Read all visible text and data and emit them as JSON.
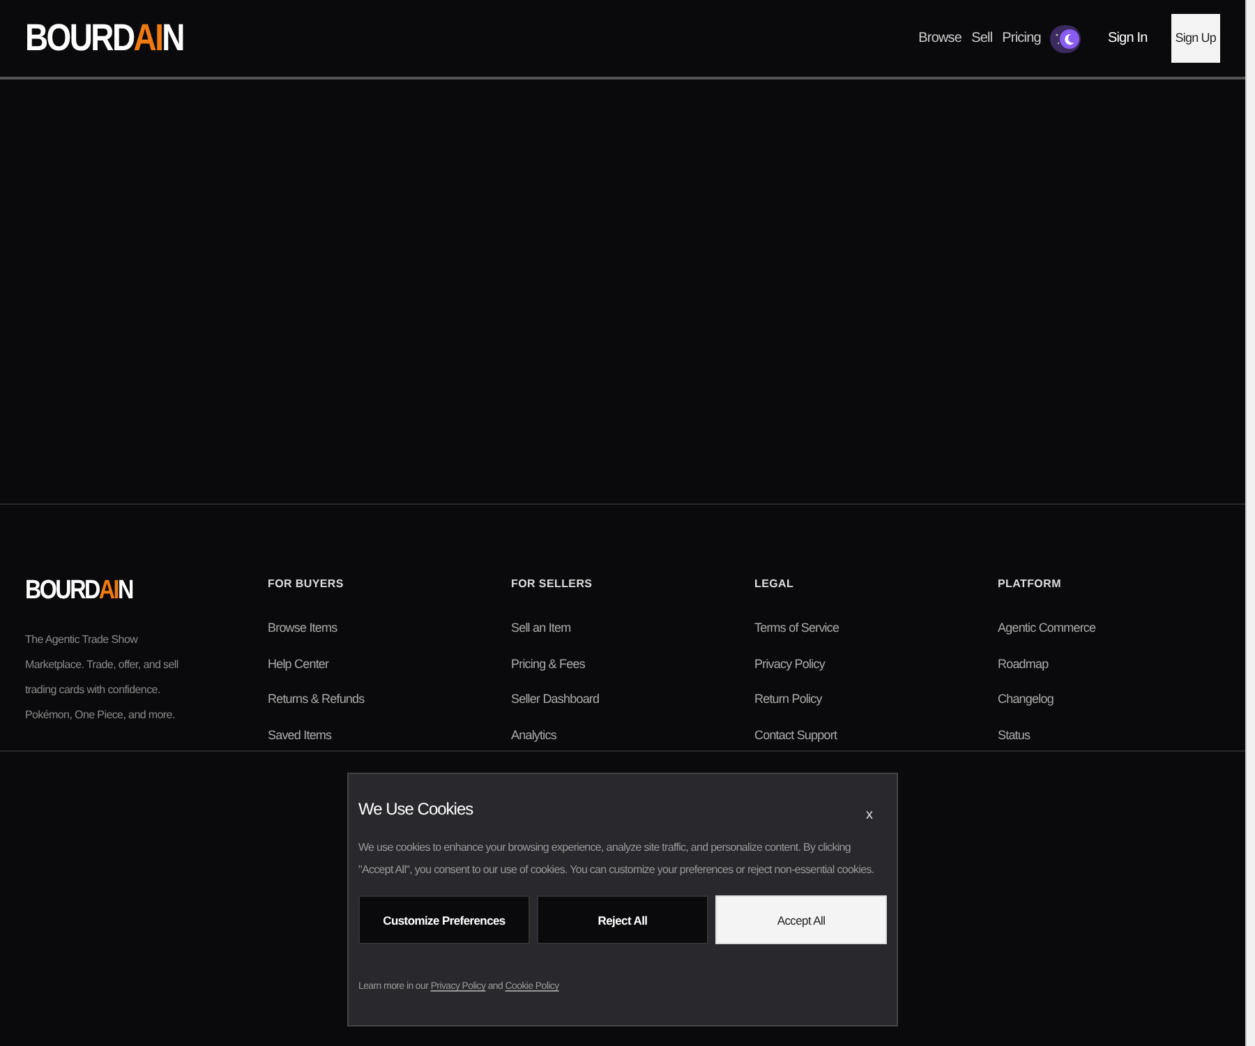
{
  "header": {
    "logo": [
      {
        "text": "BOURD",
        "accent": false
      },
      {
        "text": "AI",
        "accent": true
      },
      {
        "text": "N",
        "accent": false
      }
    ],
    "nav": [
      "Browse",
      "Sell",
      "Pricing"
    ],
    "sign_in": "Sign In",
    "sign_up": "Sign Up"
  },
  "footer": {
    "logo": [
      {
        "text": "BOURD",
        "accent": false
      },
      {
        "text": "AI",
        "accent": true
      },
      {
        "text": "N",
        "accent": false
      }
    ],
    "tagline": "The Agentic Trade Show Marketplace. Trade, offer, and sell trading cards with confidence. Pokémon, One Piece, and more.",
    "columns": [
      {
        "heading": "FOR BUYERS",
        "links": [
          "Browse Items",
          "Help Center",
          "Returns & Refunds",
          "Saved Items"
        ]
      },
      {
        "heading": "FOR SELLERS",
        "links": [
          "Sell an Item",
          "Pricing & Fees",
          "Seller Dashboard",
          "Analytics"
        ]
      },
      {
        "heading": "LEGAL",
        "links": [
          "Terms of Service",
          "Privacy Policy",
          "Return Policy",
          "Contact Support"
        ]
      },
      {
        "heading": "PLATFORM",
        "links": [
          "Agentic Commerce",
          "Roadmap",
          "Changelog",
          "Status"
        ]
      }
    ]
  },
  "cookie_banner": {
    "title": "We Use Cookies",
    "close": "x",
    "message": "We use cookies to enhance your browsing experience, analyze site traffic, and personalize content. By clicking \"Accept All\", you consent to our use of cookies. You can customize your preferences or reject non-essential cookies.",
    "buttons": [
      {
        "label": "Customize Preferences",
        "kind": "secondary"
      },
      {
        "label": "Reject All",
        "kind": "secondary"
      },
      {
        "label": "Accept All",
        "kind": "primary"
      }
    ],
    "footnote": {
      "before": "Learn more in our",
      "link_1": "Privacy Policy",
      "middle": "and",
      "link_2": "Cookie Policy"
    }
  }
}
